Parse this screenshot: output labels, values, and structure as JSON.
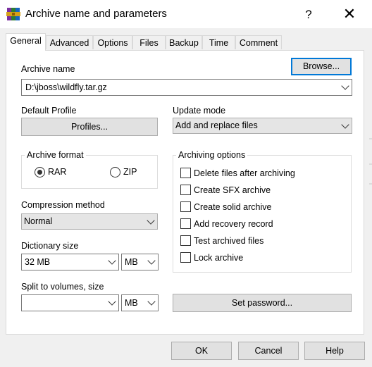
{
  "window": {
    "title": "Archive name and parameters",
    "help": "?",
    "close": "✕"
  },
  "tabs": [
    {
      "label": "General",
      "active": true
    },
    {
      "label": "Advanced"
    },
    {
      "label": "Options"
    },
    {
      "label": "Files"
    },
    {
      "label": "Backup"
    },
    {
      "label": "Time"
    },
    {
      "label": "Comment"
    }
  ],
  "archive_name": {
    "label": "Archive name",
    "value": "D:\\jboss\\wildfly.tar.gz",
    "browse_label": "Browse..."
  },
  "profile": {
    "label": "Default Profile",
    "button_label": "Profiles..."
  },
  "update_mode": {
    "label": "Update mode",
    "value": "Add and replace files"
  },
  "archive_format": {
    "label": "Archive format",
    "options": [
      {
        "label": "RAR",
        "selected": true
      },
      {
        "label": "ZIP",
        "selected": false
      }
    ]
  },
  "archiving_options": {
    "label": "Archiving options",
    "items": [
      {
        "label": "Delete files after archiving",
        "checked": false
      },
      {
        "label": "Create SFX archive",
        "checked": false
      },
      {
        "label": "Create solid archive",
        "checked": false
      },
      {
        "label": "Add recovery record",
        "checked": false
      },
      {
        "label": "Test archived files",
        "checked": false
      },
      {
        "label": "Lock archive",
        "checked": false
      }
    ]
  },
  "compression": {
    "label": "Compression method",
    "value": "Normal"
  },
  "dictionary": {
    "label": "Dictionary size",
    "value": "32 MB",
    "unit": "MB"
  },
  "split": {
    "label": "Split to volumes, size",
    "value": "",
    "unit": "MB"
  },
  "set_password_label": "Set password...",
  "footer": {
    "ok": "OK",
    "cancel": "Cancel",
    "help": "Help"
  }
}
